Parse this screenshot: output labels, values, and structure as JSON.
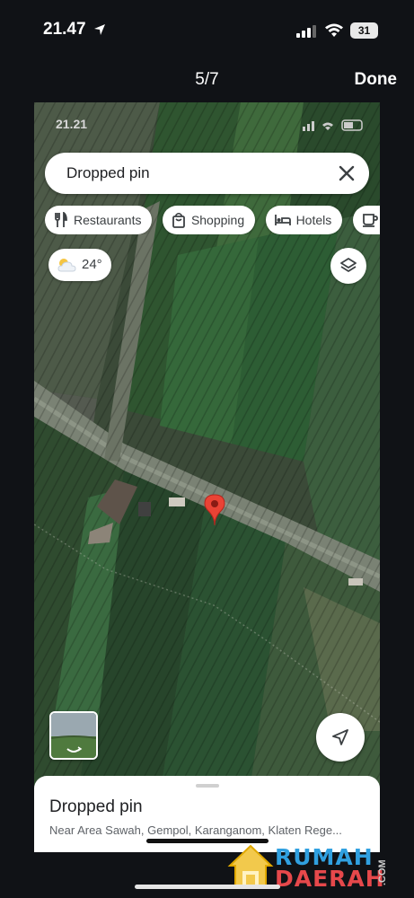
{
  "status_bar": {
    "time": "21.47",
    "battery": "31"
  },
  "viewer": {
    "counter": "5/7",
    "done_label": "Done"
  },
  "inner_status": {
    "time": "21.21"
  },
  "search": {
    "value": "Dropped pin"
  },
  "chips": [
    {
      "label": "Restaurants",
      "icon": "fork-knife-icon"
    },
    {
      "label": "Shopping",
      "icon": "shopping-bag-icon"
    },
    {
      "label": "Hotels",
      "icon": "bed-icon"
    },
    {
      "label": "",
      "icon": "coffee-icon"
    }
  ],
  "weather": {
    "temp": "24°",
    "icon": "partly-cloudy-icon"
  },
  "place_sheet": {
    "title": "Dropped pin",
    "address": "Near Area Sawah, Gempol, Karanganom, Klaten Rege..."
  },
  "watermark": {
    "line1": "RUMAH",
    "line2": "DAERAH",
    "suffix": ".COM"
  },
  "colors": {
    "pin": "#ea4335",
    "watermark_blue": "#30a0e0",
    "watermark_red": "#e6484b"
  }
}
